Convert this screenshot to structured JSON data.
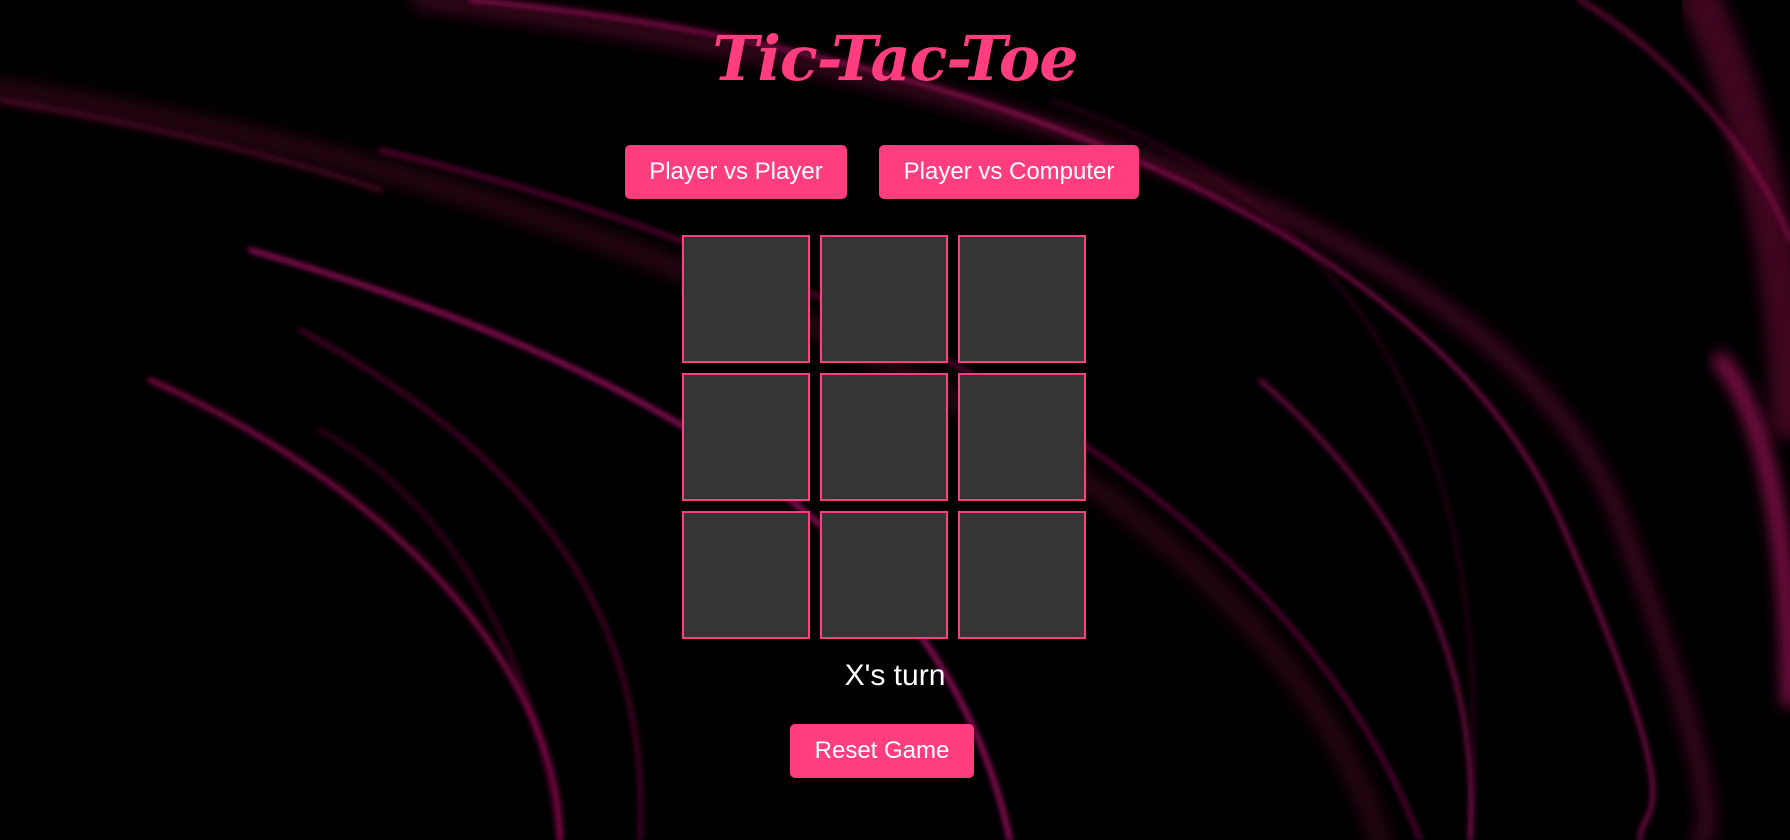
{
  "app": {
    "title": "Tic-Tac-Toe"
  },
  "modes": {
    "pvp_label": "Player vs Player",
    "pvc_label": "Player vs Computer"
  },
  "board": {
    "cells": [
      "",
      "",
      "",
      "",
      "",
      "",
      "",
      "",
      ""
    ]
  },
  "status": {
    "text": "X's turn"
  },
  "controls": {
    "reset_label": "Reset Game"
  },
  "colors": {
    "accent": "#ff3d7f",
    "cell_bg": "#353535",
    "background": "#000000",
    "swirl": "#e0146e"
  }
}
